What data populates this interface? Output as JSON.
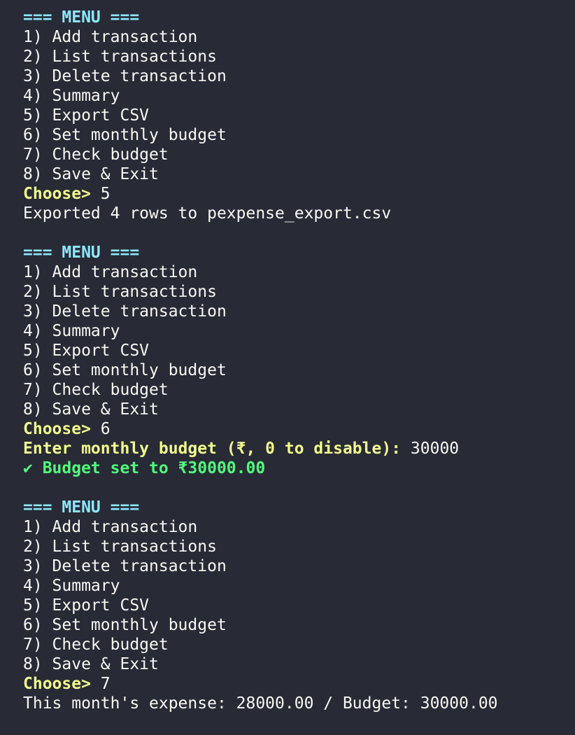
{
  "colors": {
    "background": "#282a36",
    "foreground": "#f8f8f2",
    "header": "#8be9fd",
    "prompt": "#f1fa8c",
    "success": "#50fa7b"
  },
  "menu": {
    "header": "=== MENU ===",
    "items": [
      "1) Add transaction",
      "2) List transactions",
      "3) Delete transaction",
      "4) Summary",
      "5) Export CSV",
      "6) Set monthly budget",
      "7) Check budget",
      "8) Save & Exit"
    ]
  },
  "blocks": [
    {
      "prompt": "Choose>",
      "choice": "5",
      "output": "Exported 4 rows to pexpense_export.csv"
    },
    {
      "prompt": "Choose>",
      "choice": "6",
      "budget_prompt": "Enter monthly budget (₹, 0 to disable):",
      "budget_value": "30000",
      "success": "✔ Budget set to ₹30000.00"
    },
    {
      "prompt": "Choose>",
      "choice": "7",
      "output": "This month's expense: 28000.00 / Budget: 30000.00"
    }
  ]
}
